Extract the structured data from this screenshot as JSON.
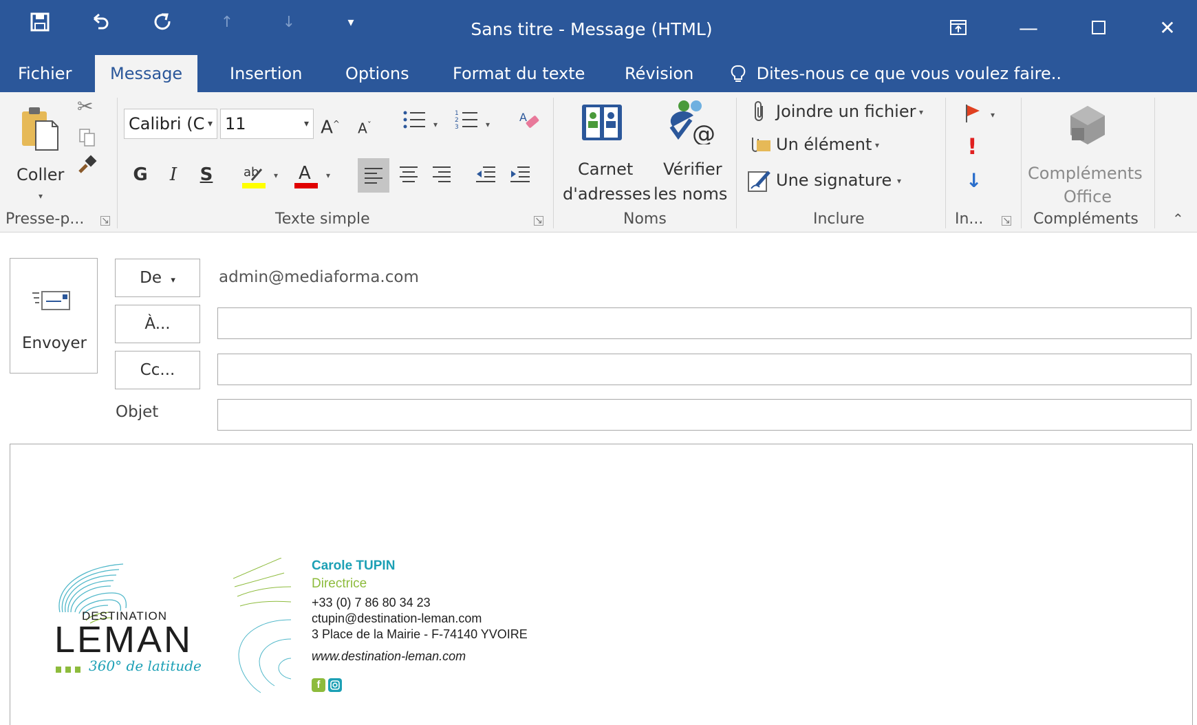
{
  "window": {
    "title": "Sans titre - Message (HTML)",
    "qat": {
      "save_icon": "save-icon",
      "undo_icon": "undo-icon",
      "redo_icon": "redo-icon",
      "up_icon": "arrow-up-icon",
      "down_icon": "arrow-down-icon",
      "customize_icon": "customize-qat-icon"
    }
  },
  "tabs": [
    {
      "label": "Fichier"
    },
    {
      "label": "Message",
      "active": true
    },
    {
      "label": "Insertion"
    },
    {
      "label": "Options"
    },
    {
      "label": "Format du texte"
    },
    {
      "label": "Révision"
    }
  ],
  "tell_me": "Dites-nous ce que vous voulez faire..",
  "ribbon": {
    "clipboard": {
      "paste_label": "Coller",
      "group_label": "Presse-p..."
    },
    "basic_text": {
      "font": "Calibri (C",
      "size": "11",
      "bold_label": "G",
      "italic_label": "I",
      "underline_label": "S",
      "group_label": "Texte simple"
    },
    "names": {
      "address_book_line1": "Carnet",
      "address_book_line2": "d'adresses",
      "check_names_line1": "Vérifier",
      "check_names_line2": "les noms",
      "group_label": "Noms"
    },
    "include": {
      "attach_file": "Joindre un fichier",
      "attach_item": "Un élément",
      "signature": "Une signature",
      "group_label": "Inclure"
    },
    "tags": {
      "group_label": "In..."
    },
    "addins": {
      "office_addins_line1": "Compléments",
      "office_addins_line2": "Office",
      "group_label": "Compléments"
    },
    "colors": {
      "highlight": "#ffff00",
      "font_color": "#e00000",
      "flag": "#e04020",
      "important": "#e02020",
      "low": "#2a6ecb"
    }
  },
  "header": {
    "send_label": "Envoyer",
    "from_label": "De",
    "from_value": "admin@mediaforma.com",
    "to_label": "À...",
    "cc_label": "Cc...",
    "subject_label": "Objet",
    "to_value": "",
    "cc_value": "",
    "subject_value": ""
  },
  "signature": {
    "logo_line1": "DESTINATION",
    "logo_line2": "LEMAN",
    "logo_tagline": "360° de latitude",
    "name": "Carole TUPIN",
    "role": "Directrice",
    "phone": "+33 (0) 7 86 80 34 23",
    "email": "ctupin@destination-leman.com",
    "address": "3 Place de la Mairie - F-74140 YVOIRE",
    "website": "www.destination-leman.com",
    "social_icons": [
      "facebook-icon",
      "instagram-icon"
    ],
    "colors": {
      "name": "#1ca0b5",
      "role": "#8dbb3c",
      "logo_teal": "#4fb7c9",
      "logo_green": "#8dbb3c"
    }
  },
  "colors": {
    "accent": "#2b579a",
    "ribbon_bg": "#f3f3f3"
  }
}
